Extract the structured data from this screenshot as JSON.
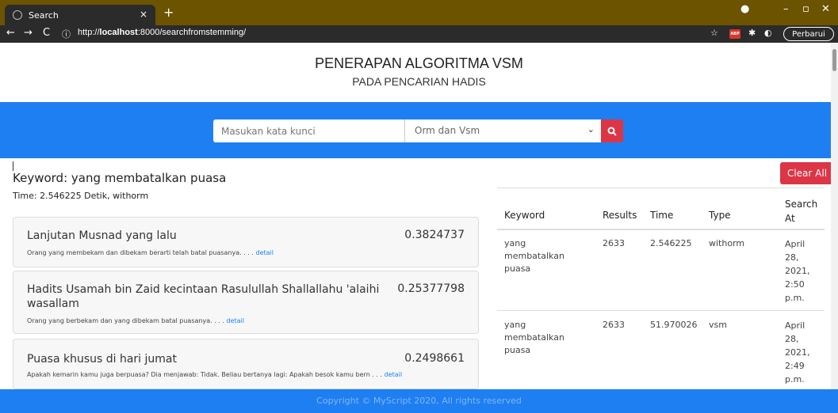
{
  "browser": {
    "tab_title": "Search",
    "tab_close": "×",
    "new_tab": "+",
    "url_prefix": "http://",
    "url_host": "localhost",
    "url_rest": ":8000/searchfromstemming/",
    "update_label": "Perbarui",
    "abp_label": "ABP"
  },
  "header": {
    "title": "PENERAPAN ALGORITMA VSM",
    "subtitle": "PADA PENCARIAN HADIS"
  },
  "search": {
    "placeholder": "Masukan kata kunci",
    "method": "Orm dan Vsm"
  },
  "results": {
    "keyword_line": "Keyword: yang membatalkan puasa",
    "time_line": "Time: 2.546225 Detik, withorm",
    "cards": [
      {
        "title": "Lanjutan Musnad yang lalu",
        "score": "0.3824737",
        "snippet": "Orang yang membekam dan dibekam berarti telah batal puasanya. . . . ",
        "link": "detail"
      },
      {
        "title": "Hadits Usamah bin Zaid kecintaan Rasulullah Shallallahu 'alaihi wasallam",
        "score": "0.25377798",
        "snippet": "Orang yang berbekam dan yang dibekam batal puasanya. . . . ",
        "link": "detail"
      },
      {
        "title": "Puasa khusus di hari jumat",
        "score": "0.2498661",
        "snippet": "Apakah kemarin kamu juga berpuasa? Dia menjawab: Tidak. Beliau bertanya lagi: Apakah besok kamu bern . . . ",
        "link": "detail"
      }
    ]
  },
  "history": {
    "clear_label": "Clear All",
    "headers": [
      "Keyword",
      "Results",
      "Time",
      "Type",
      "Search At"
    ],
    "rows": [
      {
        "keyword": "yang membatalkan puasa",
        "results": "2633",
        "time": "2.546225",
        "type": "withorm",
        "search_at": "April 28, 2021, 2:50 p.m."
      },
      {
        "keyword": "yang membatalkan puasa",
        "results": "2633",
        "time": "51.970026",
        "type": "vsm",
        "search_at": "April 28, 2021, 2:49 p.m."
      }
    ]
  },
  "footer": {
    "text": "Copyright © MyScript 2020, All rights reserved"
  },
  "colors": {
    "primary": "#1e7ff3",
    "danger": "#dc3545",
    "chrome": "#6b5300"
  }
}
